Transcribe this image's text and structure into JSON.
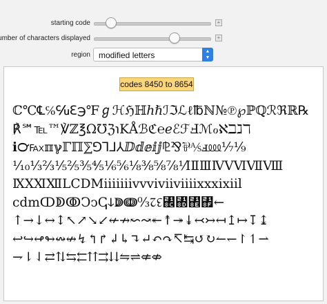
{
  "controls": {
    "starting_code": {
      "label": "starting code",
      "level_fraction": 0.14
    },
    "num_chars": {
      "label": "number of characters displayed",
      "level_fraction": 0.68
    },
    "region": {
      "label": "region",
      "selected": "modified letters"
    }
  },
  "output": {
    "range_label": "codes 8450 to 8654",
    "lines": [
      "ℂ℃℄℅℆ℇ℈℉ℊℋℌℍℎℏℐℑℒℓ℔ℕ№℗℘ℙℚℛℜℝ℞",
      "℟℠℡™℣ℤ℥Ω℧ℨ℩KÅℬℭ℮ℯℰℱℲℳℴℵℶℷℸ",
      "ℹ℺℻ℼℽℾℿ⅀⅁⅂⅃⅄ⅅⅆⅇⅈⅉ⅊⅋⅌⅍ⅎ⅏⅐⅑",
      "⅒⅓⅔⅕⅖⅗⅘⅙⅚⅛⅜⅝⅞⅟ⅠⅡⅢⅣⅤⅥⅦⅧ",
      "ⅨⅩⅪⅫⅬⅭⅮⅯⅰⅱⅲⅳⅴⅵⅶⅷⅸⅹⅺⅻⅼ",
      "ⅽⅾⅿↀↁↂↃↄↅↆↇↈ↉↊↋↌↍↎↏←",
      "↑→↓↔↕↖↗↘↙↚↛↜↝↞↟↠↡↢↣↤↥↦↧↨",
      "↩↪↫↬↭↮↯↰↱↲↳↴↵↶↷↸↹↺↻↼↽↾↿⇀",
      "⇁⇂⇃⇄⇅⇆⇇⇈⇉⇊⇋⇌⇍⇎"
    ]
  }
}
